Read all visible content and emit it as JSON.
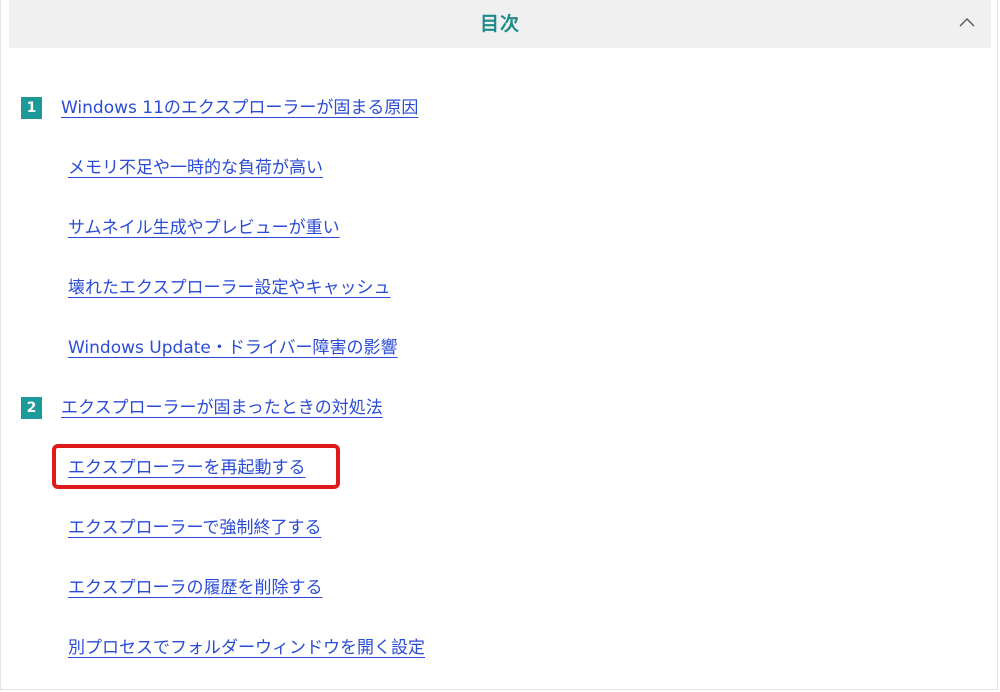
{
  "toc": {
    "title": "目次",
    "toggle_icon": "chevron-up-icon",
    "colors": {
      "title": "#1f8a8a",
      "badge": "#1b9a98",
      "link": "#2a4bd7",
      "highlight": "#e01a1a",
      "header_bg": "#f0f0f0"
    },
    "sections": [
      {
        "number": "1",
        "label": "Windows 11のエクスプローラーが固まる原因",
        "items": [
          "メモリ不足や一時的な負荷が高い",
          "サムネイル生成やプレビューが重い",
          "壊れたエクスプローラー設定やキャッシュ",
          "Windows Update・ドライバー障害の影響"
        ]
      },
      {
        "number": "2",
        "label": "エクスプローラーが固まったときの対処法",
        "items": [
          "エクスプローラーを再起動する",
          "エクスプローラーで強制終了する",
          "エクスプローラの履歴を削除する",
          "別プロセスでフォルダーウィンドウを開く設定"
        ]
      }
    ]
  }
}
